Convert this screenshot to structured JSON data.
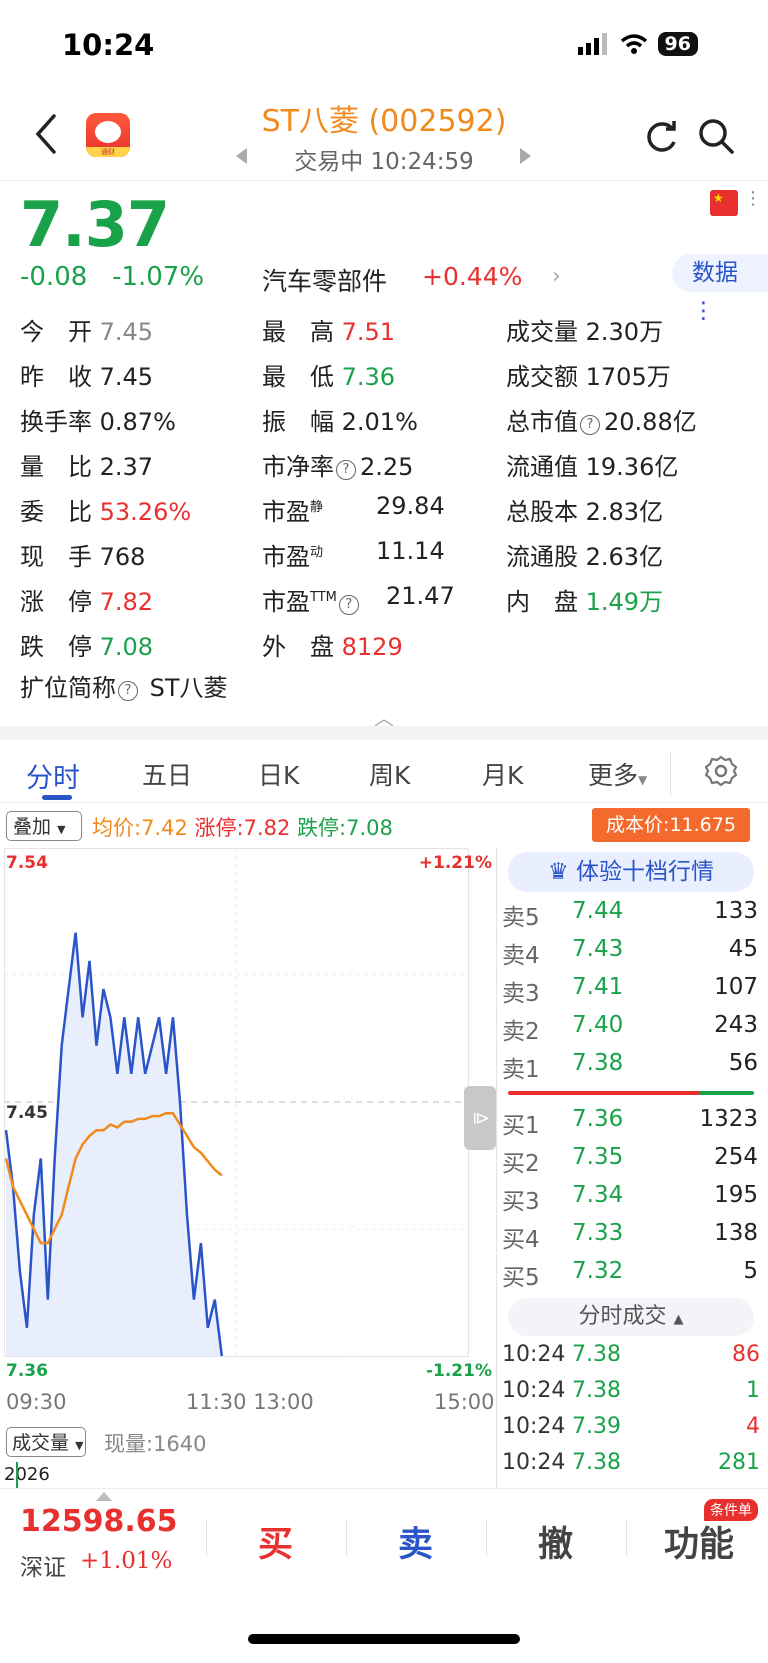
{
  "status": {
    "time": "10:24",
    "battery": "96"
  },
  "header": {
    "title": "ST八菱 (002592)",
    "trade_status": "交易中 10:24:59",
    "logo_text": "通财"
  },
  "quote": {
    "price": "7.37",
    "change": "-0.08",
    "change_pct": "-1.07%",
    "sector": "汽车零部件",
    "sector_change": "+0.44%",
    "data_button": "数据"
  },
  "stats": {
    "open_label": "今　开",
    "open": "7.45",
    "prev_close_label": "昨　收",
    "prev_close": "7.45",
    "turnover_label": "换手率",
    "turnover": "0.87%",
    "vol_ratio_label": "量　比",
    "vol_ratio": "2.37",
    "commit_ratio_label": "委　比",
    "commit_ratio": "53.26%",
    "current_hand_label": "现　手",
    "current_hand": "768",
    "limit_up_label": "涨　停",
    "limit_up": "7.82",
    "limit_down_label": "跌　停",
    "limit_down": "7.08",
    "high_label": "最　高",
    "high": "7.51",
    "low_label": "最　低",
    "low": "7.36",
    "amplitude_label": "振　幅",
    "amplitude": "2.01%",
    "pb_label": "市净率",
    "pb": "2.25",
    "pe_static_label": "市盈",
    "pe_static_sup": "静",
    "pe_static": "29.84",
    "pe_dynamic_label": "市盈",
    "pe_dynamic_sup": "动",
    "pe_dynamic": "11.14",
    "pe_ttm_label": "市盈",
    "pe_ttm_sup": "TTM",
    "pe_ttm": "21.47",
    "outer_label": "外　盘",
    "outer": "8129",
    "volume_label": "成交量",
    "volume": "2.30万",
    "amount_label": "成交额",
    "amount": "1705万",
    "mcap_label": "总市值",
    "mcap": "20.88亿",
    "float_mcap_label": "流通值",
    "float_mcap": "19.36亿",
    "total_shares_label": "总股本",
    "total_shares": "2.83亿",
    "float_shares_label": "流通股",
    "float_shares": "2.63亿",
    "inner_label": "内　盘",
    "inner": "1.49万",
    "ext_name_label": "扩位简称",
    "ext_name": "ST八菱"
  },
  "tabs": [
    "分时",
    "五日",
    "日K",
    "周K",
    "月K",
    "更多"
  ],
  "overlay": {
    "button": "叠加",
    "avg": "均价:7.42",
    "limit_up": "涨停:7.82",
    "limit_down": "跌停:7.08",
    "cost": "成本价:11.675"
  },
  "chart_data": {
    "type": "line",
    "y_labels": {
      "top": "7.54",
      "mid": "7.45",
      "bottom": "7.36",
      "top_pct": "+1.21%",
      "bottom_pct": "-1.21%"
    },
    "x_ticks": [
      "09:30",
      "11:30 13:00",
      "15:00"
    ],
    "ylim": [
      7.36,
      7.54
    ],
    "prev_close": 7.45,
    "series": [
      {
        "values": [
          7.44,
          7.42,
          7.39,
          7.37,
          7.41,
          7.43,
          7.38,
          7.43,
          7.47,
          7.49,
          7.51,
          7.48,
          7.5,
          7.47,
          7.49,
          7.48,
          7.46,
          7.48,
          7.46,
          7.48,
          7.46,
          7.47,
          7.48,
          7.46,
          7.48,
          7.45,
          7.41,
          7.38,
          7.4,
          7.37,
          7.38,
          7.36
        ]
      },
      {
        "values": [
          7.43,
          7.42,
          7.415,
          7.41,
          7.405,
          7.4,
          7.4,
          7.405,
          7.41,
          7.42,
          7.43,
          7.435,
          7.438,
          7.44,
          7.44,
          7.442,
          7.441,
          7.443,
          7.443,
          7.444,
          7.444,
          7.445,
          7.445,
          7.446,
          7.446,
          7.442,
          7.438,
          7.434,
          7.432,
          7.429,
          7.426,
          7.424
        ]
      }
    ]
  },
  "orderbook": {
    "title": "体验十档行情",
    "sell": [
      {
        "name": "卖5",
        "price": "7.44",
        "vol": "133"
      },
      {
        "name": "卖4",
        "price": "7.43",
        "vol": "45"
      },
      {
        "name": "卖3",
        "price": "7.41",
        "vol": "107"
      },
      {
        "name": "卖2",
        "price": "7.40",
        "vol": "243"
      },
      {
        "name": "卖1",
        "price": "7.38",
        "vol": "56"
      }
    ],
    "buy": [
      {
        "name": "买1",
        "price": "7.36",
        "vol": "1323"
      },
      {
        "name": "买2",
        "price": "7.35",
        "vol": "254"
      },
      {
        "name": "买3",
        "price": "7.34",
        "vol": "195"
      },
      {
        "name": "买4",
        "price": "7.33",
        "vol": "138"
      },
      {
        "name": "买5",
        "price": "7.32",
        "vol": "5"
      }
    ],
    "ticks_title": "分时成交",
    "ticks": [
      {
        "time": "10:24",
        "price": "7.38",
        "vol": "86"
      },
      {
        "time": "10:24",
        "price": "7.38",
        "vol": "1"
      },
      {
        "time": "10:24",
        "price": "7.39",
        "vol": "4"
      },
      {
        "time": "10:24",
        "price": "7.38",
        "vol": "281"
      }
    ]
  },
  "volume_bar": {
    "button": "成交量",
    "now": "现量:1640",
    "year": "2026"
  },
  "bottom": {
    "index_value": "12598.65",
    "index_name": "深证",
    "index_change": "+1.01%",
    "buy": "买",
    "sell": "卖",
    "cancel": "撤",
    "function": "功能",
    "cond_badge": "条件单"
  },
  "colors": {
    "up": "#e8302f",
    "down": "#1aa24b",
    "accent": "#2a55c9",
    "title": "#f08a1c"
  }
}
